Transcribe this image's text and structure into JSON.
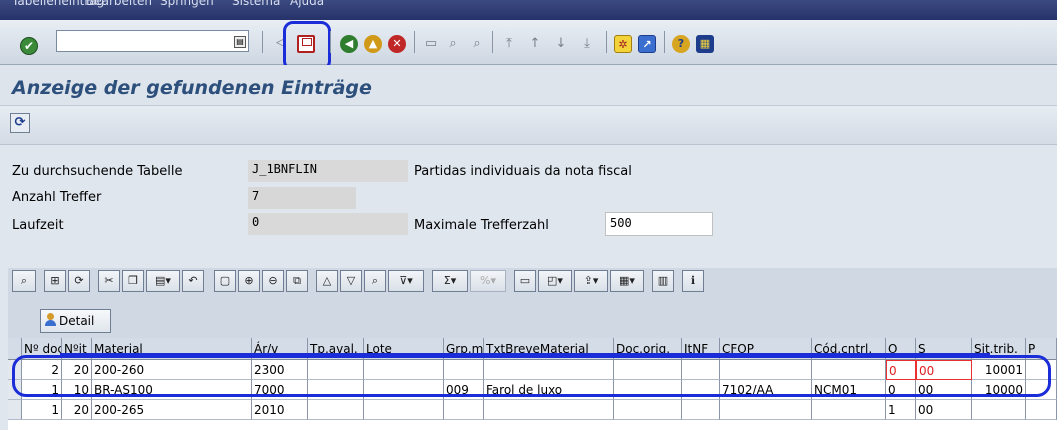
{
  "menu": [
    "Tabelleneintrag",
    "Bearbeiten",
    "Springen",
    "Sistema",
    "Ajuda"
  ],
  "toolbar": {
    "command_value": "",
    "icons": [
      "enter-icon",
      "save-icon",
      "back-icon",
      "exit-icon",
      "cancel-icon",
      "print-icon",
      "find-icon",
      "find-next-icon",
      "first-page-icon",
      "previous-page-icon",
      "next-page-icon",
      "last-page-icon",
      "new-session-icon",
      "shortcut-icon",
      "help-icon",
      "layout-icon"
    ]
  },
  "title": "Anzeige der gefundenen Einträge",
  "form": {
    "table_label": "Zu durchsuchende Tabelle",
    "table_value": "J_1BNFLIN",
    "table_desc": "Partidas individuais da nota fiscal",
    "hits_label": "Anzahl Treffer",
    "hits_value": "7",
    "runtime_label": "Laufzeit",
    "runtime_value": "0",
    "max_label": "Maximale Trefferzahl",
    "max_value": "500"
  },
  "detail_label": "Detail",
  "grid": {
    "headers": [
      "Nº doc.",
      "Nºit",
      "Material",
      "Ár/v",
      "Tp.aval.",
      "Lote",
      "Grp.merc.",
      "TxtBreveMaterial",
      "Doc.orig.",
      "ItNF",
      "CFOP",
      "Cód.cntrl.",
      "O",
      "S",
      "Sit.trib.",
      "P"
    ],
    "rows": [
      [
        "2",
        "20",
        "200-260",
        "2300",
        "",
        "",
        "",
        "",
        "",
        "",
        "",
        "",
        "0",
        "00",
        "10001",
        ""
      ],
      [
        "1",
        "10",
        "BR-AS100",
        "7000",
        "",
        "",
        "009",
        "Farol de luxo",
        "",
        "",
        "7102/AA",
        "NCM01",
        "0",
        "00",
        "10000",
        ""
      ],
      [
        "1",
        "20",
        "200-265",
        "2010",
        "",
        "",
        "",
        "",
        "",
        "",
        "",
        "",
        "1",
        "00",
        "",
        ""
      ]
    ]
  }
}
